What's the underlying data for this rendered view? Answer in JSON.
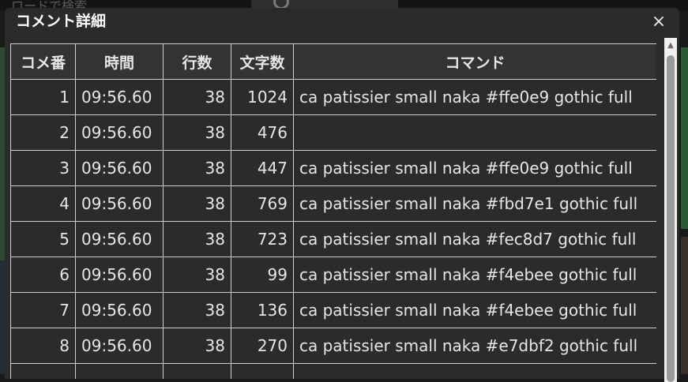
{
  "background": {
    "search_placeholder": "ロードで検索"
  },
  "dialog": {
    "title": "コメント詳細",
    "close_label": "×"
  },
  "table": {
    "headers": [
      "コメ番",
      "時間",
      "行数",
      "文字数",
      "コマンド"
    ],
    "rows": [
      {
        "no": "1",
        "time": "09:56.60",
        "lines": "38",
        "chars": "1024",
        "command": "ca patissier small naka #ffe0e9 gothic full"
      },
      {
        "no": "2",
        "time": "09:56.60",
        "lines": "38",
        "chars": "476",
        "command": ""
      },
      {
        "no": "3",
        "time": "09:56.60",
        "lines": "38",
        "chars": "447",
        "command": "ca patissier small naka #ffe0e9 gothic full"
      },
      {
        "no": "4",
        "time": "09:56.60",
        "lines": "38",
        "chars": "769",
        "command": "ca patissier small naka #fbd7e1 gothic full"
      },
      {
        "no": "5",
        "time": "09:56.60",
        "lines": "38",
        "chars": "723",
        "command": "ca patissier small naka #fec8d7 gothic full"
      },
      {
        "no": "6",
        "time": "09:56.60",
        "lines": "38",
        "chars": "99",
        "command": "ca patissier small naka #f4ebee gothic full"
      },
      {
        "no": "7",
        "time": "09:56.60",
        "lines": "38",
        "chars": "136",
        "command": "ca patissier small naka #f4ebee gothic full"
      },
      {
        "no": "8",
        "time": "09:56.60",
        "lines": "38",
        "chars": "270",
        "command": "ca patissier small naka #e7dbf2 gothic full"
      }
    ]
  },
  "icons": {
    "close": "close-icon",
    "scroll_up": "chevron-up-icon",
    "search": "search-icon"
  },
  "colors": {
    "dialog_bg": "#2b2b2b",
    "border": "#d0d0d0",
    "text": "#e6e6e6"
  }
}
